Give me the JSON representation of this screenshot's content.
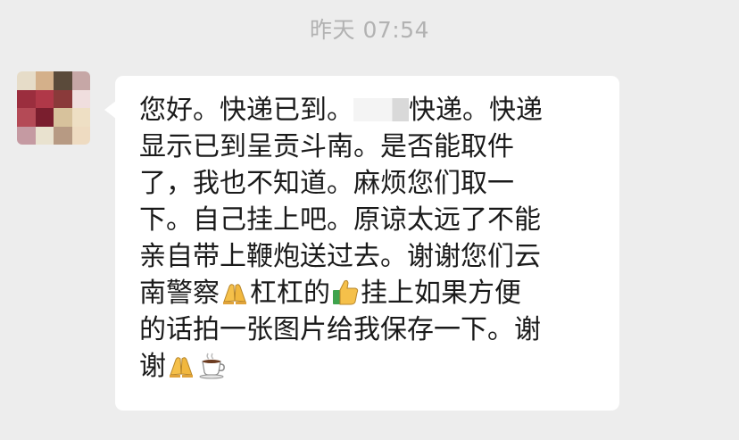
{
  "chat": {
    "timestamp": "昨天 07:54",
    "message": {
      "l1a": "您好。快递已到。",
      "l1b": "快递。快递",
      "l2": "显示已到呈贡斗南。是否能取件",
      "l3": "了，我也不知道。麻烦您们取一",
      "l4": "下。自己挂上吧。原谅太远了不能",
      "l5": "亲自带上鞭炮送过去。谢谢您们云",
      "l6a": "南警察",
      "l6b": "杠杠的",
      "l6c": "挂上如果方便",
      "l7": "的话拍一张图片给我保存一下。谢",
      "l8a": "谢"
    },
    "emojis": [
      "folded-hands-icon",
      "thumbs-up-icon",
      "folded-hands-icon",
      "coffee-icon"
    ],
    "avatar_colors": [
      "#e6dcc8",
      "#d4b08a",
      "#5a4a3a",
      "#c6a7a6",
      "#9b2e3e",
      "#b03848",
      "#8a3a3a",
      "#f0dede",
      "#b44a56",
      "#7a1e2e",
      "#d7c29c",
      "#eedfc4",
      "#c59aa2",
      "#e9e2cf",
      "#b79a83",
      "#eedbc1"
    ]
  }
}
